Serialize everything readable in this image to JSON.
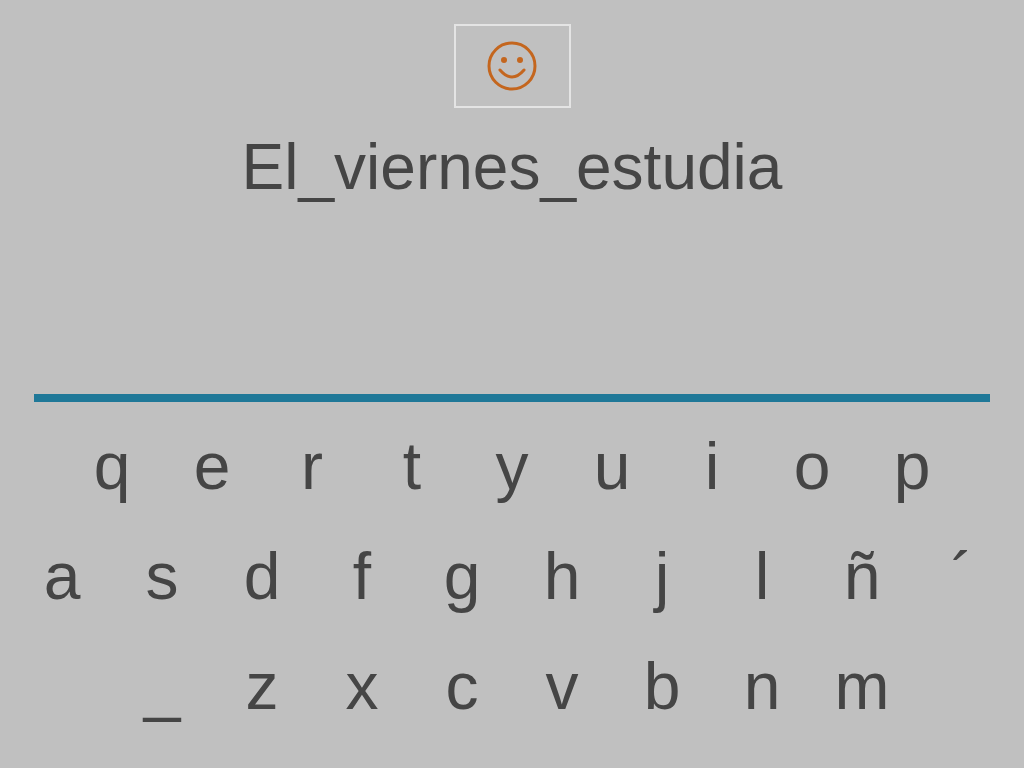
{
  "phrase": "El_viernes_estudia",
  "keyboard": {
    "rows": [
      [
        "q",
        "e",
        "r",
        "t",
        "y",
        "u",
        "i",
        "o",
        "p"
      ],
      [
        "a",
        "s",
        "d",
        "f",
        "g",
        "h",
        "j",
        "l",
        "ñ",
        "´"
      ],
      [
        "_",
        "z",
        "x",
        "c",
        "v",
        "b",
        "n",
        "m"
      ]
    ]
  }
}
